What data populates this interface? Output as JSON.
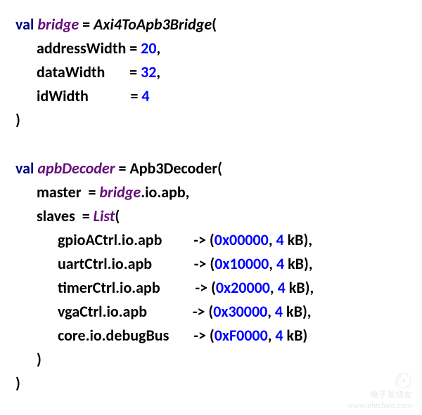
{
  "code": {
    "kw_val": "val",
    "bridge_name": "bridge",
    "eq": " = ",
    "bridge_type": "Axi4ToApb3Bridge",
    "open_paren": "(",
    "close_paren": ")",
    "bridge_params": {
      "p1": {
        "name": "addressWidth",
        "eq": " = ",
        "val": "20",
        "comma": ","
      },
      "p2": {
        "name": "dataWidth",
        "pad": "       ",
        "eq": "= ",
        "val": "32",
        "comma": ","
      },
      "p3": {
        "name": "idWidth",
        "pad": "            ",
        "eq": "= ",
        "val": "4",
        "comma": ""
      }
    },
    "decoder_name": "apbDecoder",
    "decoder_type": "Apb3Decoder",
    "decoder_params": {
      "master_label": "master  = ",
      "master_ref": "bridge",
      "master_chain": ".io.apb,",
      "slaves_label": "slaves  = ",
      "list_call": "List"
    },
    "slaves": [
      {
        "path": "gpioACtrl.io.apb",
        "pad": "         ",
        "arrow": "-> (",
        "hex": "0x00000",
        "comma1": ", ",
        "sz": "4",
        "unit": " kB",
        "close": "),"
      },
      {
        "path": "uartCtrl.io.apb",
        "pad": "            ",
        "arrow": "-> (",
        "hex": "0x10000",
        "comma1": ", ",
        "sz": "4",
        "unit": " kB",
        "close": "),"
      },
      {
        "path": "timerCtrl.io.apb",
        "pad": "          ",
        "arrow": "-> (",
        "hex": "0x20000",
        "comma1": ", ",
        "sz": "4",
        "unit": " kB",
        "close": "),"
      },
      {
        "path": "vgaCtrl.io.apb",
        "pad": "             ",
        "arrow": "-> (",
        "hex": "0x30000",
        "comma1": ", ",
        "sz": "4",
        "unit": " kB",
        "close": "),"
      },
      {
        "path": "core.io.debugBus",
        "pad": "       ",
        "arrow": "-> (",
        "hex": "0xF0000",
        "comma1": ", ",
        "sz": "4",
        "unit": " kB",
        "close": ")"
      }
    ]
  },
  "watermark": {
    "brand": "电子发烧友",
    "url": "www.elecfans.com"
  }
}
